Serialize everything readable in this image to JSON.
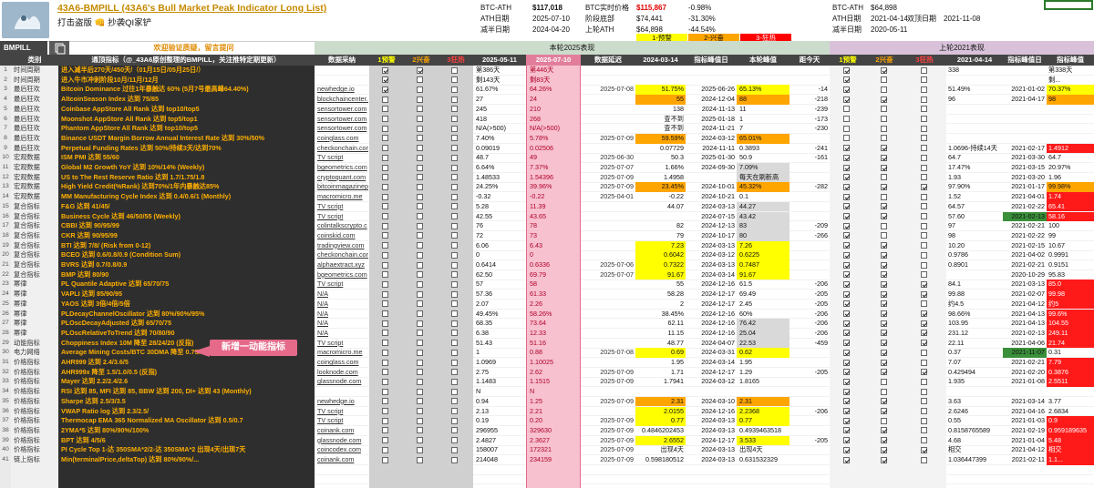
{
  "header": {
    "title": "43A6-BMPILL (43A6's Bull Market Peak Indicator Long List)",
    "subtitle": "打击盗版 👊 抄袭QI家铲",
    "current_block": [
      {
        "label": "BTC-ATH",
        "value": "$117,018",
        "v2": "BTC实时价格",
        "v3": "$115,867",
        "v4": "-0.98%"
      },
      {
        "label": "ATH日期",
        "value": "2025-07-10",
        "v2": "阶段底部",
        "v3": "$74,441",
        "v4": "-31.30%"
      },
      {
        "label": "减半日期",
        "value": "2024-04-20",
        "v2": "上轮ATH",
        "v3": "$64,898",
        "v4": "-44.54%"
      }
    ],
    "legend": {
      "warn": "1-预警",
      "alert": "2-兴奋",
      "bubble": "3-狂热"
    },
    "prev_block": [
      {
        "label": "BTC-ATH",
        "value": "$64,898",
        "v2": "",
        "v3": ""
      },
      {
        "label": "ATH日期",
        "value": "2021-04-14",
        "v2": "双顶日期",
        "v3": "2021-11-08"
      },
      {
        "label": "减半日期",
        "value": "2020-05-11",
        "v2": "",
        "v3": ""
      }
    ]
  },
  "tab": {
    "label": "BMPILL"
  },
  "banner": {
    "welcome": "欢迎验证质疑，留言提问",
    "cycle": "本轮2025表现",
    "prev_cycle": "上轮2021表现"
  },
  "columns": [
    "类别",
    "通顶指标（@_43A6原创整理的BMPILL，关注推特定期更新）",
    "数据采纳",
    "1预警",
    "2兴奋",
    "3狂热",
    "2025-05-11",
    "2025-07-10",
    "数据延迟",
    "2024-03-14",
    "指标峰值日",
    "本轮峰值",
    "距今天",
    "1预警",
    "2兴奋",
    "3狂热",
    "2021-04-14",
    "指标峰值日",
    "指标峰值"
  ],
  "rows": [
    {
      "n": "1",
      "cat": "时间周期",
      "ind": "进入减半后270天/450天/（01月15日/05月25日/）",
      "src": "",
      "c1": 1,
      "c2": 1,
      "c3": 0,
      "d1": "第386天",
      "d2": "第446天",
      "lag": "",
      "v3": "",
      "pk": "",
      "cur": "",
      "dist": "",
      "p1": 1,
      "p2": 1,
      "p3": 0,
      "o1": "338",
      "opk": "",
      "ov": "第338天"
    },
    {
      "n": "2",
      "cat": "时间周期",
      "ind": "进入牛市冲刺阶段10月/11月/12月",
      "src": "",
      "c1": 1,
      "c2": 0,
      "c3": 0,
      "d1": "剩143天",
      "d2": "剩83天",
      "lag": "",
      "v3": "",
      "pk": "",
      "cur": "",
      "dist": "",
      "p1": 1,
      "p2": 0,
      "p3": 0,
      "o1": "",
      "opk": "",
      "ov": "剩..."
    },
    {
      "n": "3",
      "cat": "最后狂欢",
      "ind": "Bitcoin Dominance 过往1年暴触达 60% (5月7号最高峰64.40%)",
      "src": "newhedge.io",
      "c1": 1,
      "c2": 0,
      "c3": 0,
      "d1": "61.67%",
      "d2": "64.26%",
      "lag": "2025-07-08",
      "v3": "51.75%",
      "pk": "2025-06-26",
      "cur": "65.13%",
      "dist": "-14",
      "p1": 1,
      "p2": 0,
      "p3": 0,
      "o1": "51.49%",
      "opk": "2021-01-02",
      "ov": "70.37%"
    },
    {
      "n": "4",
      "cat": "最后狂欢",
      "ind": "AltcoinSeason Index 达到 75/85",
      "src": "blockchaincenter.n",
      "c1": 0,
      "c2": 0,
      "c3": 0,
      "d1": "27",
      "d2": "24",
      "lag": "",
      "v3": "55",
      "pk": "2024-12-04",
      "cur": "88",
      "dist": "-218",
      "p1": 1,
      "p2": 1,
      "p3": 0,
      "o1": "96",
      "opk": "2021-04-17",
      "ov": "98"
    },
    {
      "n": "5",
      "cat": "最后狂欢",
      "ind": "Coinbase AppStore All Rank 达到 top10/top5",
      "src": "sensortower.com",
      "c1": 0,
      "c2": 0,
      "c3": 0,
      "d1": "245",
      "d2": "210",
      "lag": "",
      "v3": "138",
      "pk": "2024-11-13",
      "cur": "11",
      "dist": "-239",
      "p1": 0,
      "p2": 0,
      "p3": 0,
      "o1": "",
      "opk": "",
      "ov": ""
    },
    {
      "n": "6",
      "cat": "最后狂欢",
      "ind": "Moonshot AppStore All Rank 达到 top5/top1",
      "src": "sensortower.com",
      "c1": 0,
      "c2": 0,
      "c3": 0,
      "d1": "418",
      "d2": "268",
      "lag": "",
      "v3": "查不到",
      "pk": "2025-01-18",
      "cur": "1",
      "dist": "-173",
      "p1": 0,
      "p2": 0,
      "p3": 0,
      "o1": "",
      "opk": "",
      "ov": ""
    },
    {
      "n": "7",
      "cat": "最后狂欢",
      "ind": "Phantom AppStore All Rank 达到 top10/top5",
      "src": "sensortower.com",
      "c1": 0,
      "c2": 0,
      "c3": 0,
      "d1": "N/A(>500)",
      "d2": "N/A(>500)",
      "lag": "",
      "v3": "查不到",
      "pk": "2024-11-21",
      "cur": "7",
      "dist": "-230",
      "p1": 0,
      "p2": 0,
      "p3": 0,
      "o1": "",
      "opk": "",
      "ov": ""
    },
    {
      "n": "8",
      "cat": "最后狂欢",
      "ind": "Binance USDT Margin Borrow Annual Interest Rate 达到 30%/50%",
      "src": "coinglass.com",
      "c1": 0,
      "c2": 0,
      "c3": 0,
      "d1": "7.40%",
      "d2": "5.78%",
      "lag": "2025-07-09",
      "v3": "59.59%",
      "pk": "2024-03-12",
      "cur": "65.01%",
      "dist": "",
      "p1": 0,
      "p2": 0,
      "p3": 0,
      "o1": "",
      "opk": "",
      "ov": ""
    },
    {
      "n": "9",
      "cat": "最后狂欢",
      "ind": "Perpetual Funding Rates 达到 50%/持续3天/达到70%",
      "src": "checkonchain.com",
      "c1": 0,
      "c2": 0,
      "c3": 0,
      "d1": "0.09019",
      "d2": "0.02506",
      "lag": "",
      "v3": "0.07729",
      "pk": "2024-11-11",
      "cur": "0.3893",
      "dist": "-241",
      "p1": 1,
      "p2": 1,
      "p3": 0,
      "o1": "1.0696-持续14天",
      "opk": "2021-02-17",
      "ov": "1.4912"
    },
    {
      "n": "10",
      "cat": "宏观数据",
      "ind": "ISM PMI 达到 55/60",
      "src": "TV script",
      "c1": 0,
      "c2": 0,
      "c3": 0,
      "d1": "48.7",
      "d2": "49",
      "lag": "2025-06-30",
      "v3": "50.3",
      "pk": "2025-01-30",
      "cur": "50.9",
      "dist": "-161",
      "p1": 1,
      "p2": 1,
      "p3": 0,
      "o1": "64.7",
      "opk": "2021-03-30",
      "ov": "64.7"
    },
    {
      "n": "11",
      "cat": "宏观数据",
      "ind": "Global M2 Growth YoY 达到 10%/14% (Weekly)",
      "src": "bgeometrics.com",
      "c1": 0,
      "c2": 0,
      "c3": 0,
      "d1": "6.64%",
      "d2": "7.37%",
      "lag": "2025-07-07",
      "v3": "1.66%",
      "pk": "2024-09-30",
      "cur": "7.09%",
      "dist": "",
      "p1": 1,
      "p2": 1,
      "p3": 0,
      "o1": "17.47%",
      "opk": "2021-03-15",
      "ov": "20.97%"
    },
    {
      "n": "12",
      "cat": "宏观数据",
      "ind": "US to The Rest Reserve Ratio 达到 1.7/1.75/1.8",
      "src": "cryptoquant.com",
      "c1": 0,
      "c2": 0,
      "c3": 0,
      "d1": "1.48533",
      "d2": "1.54396",
      "lag": "2025-07-09",
      "v3": "1.4958",
      "pk": "",
      "cur": "每天在刷新高",
      "dist": "",
      "p1": 1,
      "p2": 0,
      "p3": 0,
      "o1": "1.93",
      "opk": "2021-03-20",
      "ov": "1.96"
    },
    {
      "n": "13",
      "cat": "宏观数据",
      "ind": "High Yield Credit(%Rank) 达到70%/1年内暴触达85%",
      "src": "bitcoinmagazinepro",
      "c1": 0,
      "c2": 0,
      "c3": 0,
      "d1": "24.25%",
      "d2": "39.96%",
      "lag": "2025-07-09",
      "v3": "23.45%",
      "pk": "2024-10-01",
      "cur": "45.32%",
      "dist": "-282",
      "p1": 1,
      "p2": 1,
      "p3": 1,
      "o1": "97.90%",
      "opk": "2021-01-17",
      "ov": "99.98%"
    },
    {
      "n": "14",
      "cat": "宏观数据",
      "ind": "MM Manufacturing Cycle Index 达到 0.4/0.6/1 (Monthly)",
      "src": "macromicro.me",
      "c1": 0,
      "c2": 0,
      "c3": 0,
      "d1": "-0.32",
      "d2": "-0.22",
      "lag": "2025-04-01",
      "v3": "-0.22",
      "pk": "2024-10-21",
      "cur": "0.1",
      "dist": "",
      "p1": 1,
      "p2": 0,
      "p3": 0,
      "o1": "1.52",
      "opk": "2021-04-01",
      "ov": "1.74"
    },
    {
      "n": "15",
      "cat": "复合指标",
      "ind": "F&G 达到 41/45/",
      "src": "TV script",
      "c1": 0,
      "c2": 0,
      "c3": 0,
      "d1": "5.28",
      "d2": "11.39",
      "lag": "",
      "v3": "44.07",
      "pk": "2024-03-13",
      "cur": "44.27",
      "dist": "",
      "p1": 1,
      "p2": 1,
      "p3": 0,
      "o1": "64.57",
      "opk": "2021-02-22",
      "ov": "65.41"
    },
    {
      "n": "16",
      "cat": "复合指标",
      "ind": "Business Cycle 达到 46/50/55 (Weekly)",
      "src": "TV script",
      "c1": 0,
      "c2": 0,
      "c3": 0,
      "d1": "42.55",
      "d2": "43.65",
      "lag": "",
      "v3": "",
      "pk": "2024-07-15",
      "cur": "43.42",
      "dist": "",
      "p1": 1,
      "p2": 1,
      "p3": 0,
      "o1": "57.60",
      "opk": "2021-02-13",
      "ov": "58.16"
    },
    {
      "n": "17",
      "cat": "复合指标",
      "ind": "CBBI 达到 90/95/99",
      "src": "colintalkscrypto.c",
      "c1": 0,
      "c2": 0,
      "c3": 0,
      "d1": "76",
      "d2": "78",
      "lag": "",
      "v3": "82",
      "pk": "2024-12-13",
      "cur": "83",
      "dist": "-209",
      "p1": 1,
      "p2": 0,
      "p3": 0,
      "o1": "97",
      "opk": "2021-02-21",
      "ov": "100"
    },
    {
      "n": "18",
      "cat": "复合指标",
      "ind": "CKR 达到 90/95/99",
      "src": "coinskid.com",
      "c1": 0,
      "c2": 0,
      "c3": 0,
      "d1": "72",
      "d2": "73",
      "lag": "",
      "v3": "79",
      "pk": "2024-10-17",
      "cur": "80",
      "dist": "-266",
      "p1": 1,
      "p2": 0,
      "p3": 0,
      "o1": "98",
      "opk": "2021-02-22",
      "ov": "99"
    },
    {
      "n": "19",
      "cat": "复合指标",
      "ind": "BTI 达到 7/8/ (Risk from 0-12)",
      "src": "tradingview.com",
      "c1": 0,
      "c2": 0,
      "c3": 0,
      "d1": "6.06",
      "d2": "6.43",
      "lag": "",
      "v3": "7.23",
      "pk": "2024-03-13",
      "cur": "7.26",
      "dist": "",
      "p1": 1,
      "p2": 1,
      "p3": 0,
      "o1": "10.20",
      "opk": "2021-02-15",
      "ov": "10.67"
    },
    {
      "n": "20",
      "cat": "复合指标",
      "ind": "BCEO 达到 0.6/0.8/0.9 (Condition Sum)",
      "src": "checkonchain.com",
      "c1": 0,
      "c2": 0,
      "c3": 0,
      "d1": "0",
      "d2": "0",
      "lag": "",
      "v3": "0.6042",
      "pk": "2024-03-12",
      "cur": "0.6225",
      "dist": "",
      "p1": 1,
      "p2": 1,
      "p3": 0,
      "o1": "0.9786",
      "opk": "2021-04-02",
      "ov": "0.9991"
    },
    {
      "n": "21",
      "cat": "复合指标",
      "ind": "BVRS 达到 0.7/0.8/0.9",
      "src": "alphaextract.xyz",
      "c1": 0,
      "c2": 0,
      "c3": 0,
      "d1": "0.6414",
      "d2": "0.6336",
      "lag": "2025-07-06",
      "v3": "0.7322",
      "pk": "2024-03-13",
      "cur": "0.7487",
      "dist": "",
      "p1": 1,
      "p2": 1,
      "p3": 0,
      "o1": "0.8901",
      "opk": "2021-02-21",
      "ov": "0.9151"
    },
    {
      "n": "22",
      "cat": "复合指标",
      "ind": "BMP 达到 80/90",
      "src": "bgeometrics.com",
      "c1": 0,
      "c2": 0,
      "c3": 0,
      "d1": "62.50",
      "d2": "69.79",
      "lag": "2025-07-07",
      "v3": "91.67",
      "pk": "2024-03-14",
      "cur": "91.67",
      "dist": "",
      "p1": 1,
      "p2": 1,
      "p3": 0,
      "o1": "",
      "opk": "2020-10-29",
      "ov": "95.83"
    },
    {
      "n": "23",
      "cat": "幂律",
      "ind": "PL Quantile Adaptive 达到 65/70/75",
      "src": "TV script",
      "c1": 0,
      "c2": 0,
      "c3": 0,
      "d1": "57",
      "d2": "58",
      "lag": "",
      "v3": "55",
      "pk": "2024-12-16",
      "cur": "61.5",
      "dist": "-206",
      "p1": 1,
      "p2": 1,
      "p3": 1,
      "o1": "84.1",
      "opk": "2021-03-13",
      "ov": "85.0"
    },
    {
      "n": "24",
      "cat": "幂律",
      "ind": "VAPLI 达到 85/90/95",
      "src": "N/A",
      "c1": 0,
      "c2": 0,
      "c3": 0,
      "d1": "57.36",
      "d2": "61.33",
      "lag": "",
      "v3": "58.28",
      "pk": "2024-12-17",
      "cur": "69.49",
      "dist": "-205",
      "p1": 1,
      "p2": 1,
      "p3": 1,
      "o1": "99.88",
      "opk": "2021-02-07",
      "ov": "99.98"
    },
    {
      "n": "25",
      "cat": "幂律",
      "ind": "YAOS 达到 3倍/4倍/5倍",
      "src": "N/A",
      "c1": 0,
      "c2": 0,
      "c3": 0,
      "d1": "2.07",
      "d2": "2.26",
      "lag": "",
      "v3": "2",
      "pk": "2024-12-17",
      "cur": "2.45",
      "dist": "-205",
      "p1": 1,
      "p2": 1,
      "p3": 0,
      "o1": "约4.5",
      "opk": "2021-04-12",
      "ov": "约5"
    },
    {
      "n": "26",
      "cat": "幂律",
      "ind": "PLDecayChannelOscillator 达到 80%/90%/95%",
      "src": "N/A",
      "c1": 0,
      "c2": 0,
      "c3": 0,
      "d1": "49.45%",
      "d2": "58.26%",
      "lag": "",
      "v3": "38.45%",
      "pk": "2024-12-16",
      "cur": "60%",
      "dist": "-206",
      "p1": 1,
      "p2": 1,
      "p3": 1,
      "o1": "98.66%",
      "opk": "2021-04-13",
      "ov": "99.6%"
    },
    {
      "n": "27",
      "cat": "幂律",
      "ind": "PLOscDecayAdjusted 达到 65/70/75",
      "src": "N/A",
      "c1": 0,
      "c2": 0,
      "c3": 0,
      "d1": "68.35",
      "d2": "73.64",
      "lag": "",
      "v3": "62.11",
      "pk": "2024-12-16",
      "cur": "76.42",
      "dist": "-206",
      "p1": 1,
      "p2": 1,
      "p3": 1,
      "o1": "103.95",
      "opk": "2021-04-13",
      "ov": "104.55"
    },
    {
      "n": "28",
      "cat": "幂律",
      "ind": "PLOscRelativeToTrend 达到 70/80/90",
      "src": "N/A",
      "c1": 0,
      "c2": 0,
      "c3": 0,
      "d1": "6.38",
      "d2": "12.33",
      "lag": "",
      "v3": "11.15",
      "pk": "2024-12-16",
      "cur": "25.04",
      "dist": "-206",
      "p1": 1,
      "p2": 1,
      "p3": 1,
      "o1": "231.12",
      "opk": "2021-02-13",
      "ov": "249.11"
    },
    {
      "n": "29",
      "cat": "动能指标",
      "ind": "Choppiness Index 10M 降至 28/24/20 (反指)",
      "src": "TV script",
      "c1": 0,
      "c2": 0,
      "c3": 0,
      "d1": "51.43",
      "d2": "51.16",
      "lag": "",
      "v3": "48.77",
      "pk": "2024-04-07",
      "cur": "22.53",
      "dist": "-459",
      "p1": 1,
      "p2": 1,
      "p3": 1,
      "o1": "22.11",
      "opk": "2021-04-06",
      "ov": "21.74"
    },
    {
      "n": "30",
      "cat": "电力网络",
      "ind": "Average Mining Costs/BTC 30DMA 降至 0.75/0.5/0.45 (反指)",
      "src": "macromicro.me",
      "c1": 0,
      "c2": 0,
      "c3": 0,
      "d1": "1",
      "d2": "0.88",
      "lag": "2025-07-08",
      "v3": "0.69",
      "pk": "2024-03-31",
      "cur": "0.62",
      "dist": "",
      "p1": 1,
      "p2": 1,
      "p3": 0,
      "o1": "0.37",
      "opk": "2021-11-07",
      "ov": "0.31"
    },
    {
      "n": "31",
      "cat": "价格指标",
      "ind": "AHR999 达到 2.4/3.6/5",
      "src": "coinglass.com",
      "c1": 0,
      "c2": 0,
      "c3": 0,
      "d1": "1.0969",
      "d2": "1.10025",
      "lag": "",
      "v3": "1.95",
      "pk": "2024-03-14",
      "cur": "1.95",
      "dist": "",
      "p1": 1,
      "p2": 1,
      "p3": 0,
      "o1": "7.07",
      "opk": "2021-02-21",
      "ov": "7.79"
    },
    {
      "n": "32",
      "cat": "价格指标",
      "ind": "AHR999x 降至 1.5/1.0/0.5 (反指)",
      "src": "looknode.com",
      "c1": 0,
      "c2": 0,
      "c3": 0,
      "d1": "2.75",
      "d2": "2.62",
      "lag": "2025-07-09",
      "v3": "1.71",
      "pk": "2024-12-17",
      "cur": "1.29",
      "dist": "-205",
      "p1": 1,
      "p2": 1,
      "p3": 1,
      "o1": "0.429494",
      "opk": "2021-02-20",
      "ov": "0.3876"
    },
    {
      "n": "33",
      "cat": "价格指标",
      "ind": "Mayer 达到 2.2/2.4/2.6",
      "src": "glassnode.com",
      "c1": 0,
      "c2": 0,
      "c3": 0,
      "d1": "1.1483",
      "d2": "1.1515",
      "lag": "2025-07-09",
      "v3": "1.7941",
      "pk": "2024-03-12",
      "cur": "1.8165",
      "dist": "",
      "p1": 1,
      "p2": 0,
      "p3": 0,
      "o1": "1.935",
      "opk": "2021-01-08",
      "ov": "2.5511"
    },
    {
      "n": "34",
      "cat": "价格指标",
      "ind": "RSI 达到 85, MFI 达到 85, BBW 达到 200, DI+ 达到 43 (Monthly)",
      "src": "",
      "c1": 0,
      "c2": 0,
      "c3": 0,
      "d1": "N",
      "d2": "N",
      "lag": "",
      "v3": "",
      "pk": "",
      "cur": "",
      "dist": "",
      "p1": 1,
      "p2": 0,
      "p3": 0,
      "o1": "",
      "opk": "",
      "ov": ""
    },
    {
      "n": "35",
      "cat": "价格指标",
      "ind": "Sharpe 达到 2.5/3/3.5",
      "src": "newhedge.io",
      "c1": 0,
      "c2": 0,
      "c3": 0,
      "d1": "0.94",
      "d2": "1.25",
      "lag": "2025-07-09",
      "v3": "2.31",
      "pk": "2024-03-10",
      "cur": "2.31",
      "dist": "",
      "p1": 1,
      "p2": 1,
      "p3": 0,
      "o1": "3.63",
      "opk": "2021-03-14",
      "ov": "3.77"
    },
    {
      "n": "36",
      "cat": "价格指标",
      "ind": "VWAP Ratio log 达到 2.3/2.5/",
      "src": "TV script",
      "c1": 0,
      "c2": 0,
      "c3": 0,
      "d1": "2.13",
      "d2": "2.21",
      "lag": "",
      "v3": "2.0155",
      "pk": "2024-12-16",
      "cur": "2.2368",
      "dist": "-206",
      "p1": 1,
      "p2": 1,
      "p3": 0,
      "o1": "2.6246",
      "opk": "2021-04-16",
      "ov": "2.6834"
    },
    {
      "n": "37",
      "cat": "价格指标",
      "ind": "Thermocap EMA 365 Normalized MA Oscillator 达到 0.5/0.7",
      "src": "TV script",
      "c1": 0,
      "c2": 0,
      "c3": 0,
      "d1": "0.19",
      "d2": "0.20",
      "lag": "2025-07-09",
      "v3": "0.77",
      "pk": "2024-03-13",
      "cur": "0.77",
      "dist": "",
      "p1": 1,
      "p2": 0,
      "p3": 0,
      "o1": "0.55",
      "opk": "2021-01-03",
      "ov": "0.9"
    },
    {
      "n": "38",
      "cat": "价格指标",
      "ind": "2YMA*5 达到 80%/90%/100%",
      "src": "coinank.com",
      "c1": 0,
      "c2": 0,
      "c3": 0,
      "d1": "296955",
      "d2": "329630",
      "lag": "2025-07-09",
      "v3": "0.4846202453",
      "pk": "2024-03-13",
      "cur": "0.4939463518",
      "dist": "",
      "p1": 1,
      "p2": 1,
      "p3": 0,
      "o1": "0.8158765589",
      "opk": "2021-02-19",
      "ov": "0.959189635"
    },
    {
      "n": "39",
      "cat": "价格指标",
      "ind": "BPT 达到 4/5/6",
      "src": "glassnode.com",
      "c1": 0,
      "c2": 0,
      "c3": 0,
      "d1": "2.4827",
      "d2": "2.3627",
      "lag": "2025-07-09",
      "v3": "2.6552",
      "pk": "2024-12-17",
      "cur": "3.533",
      "dist": "-205",
      "p1": 1,
      "p2": 1,
      "p3": 0,
      "o1": "4.68",
      "opk": "2021-01-04",
      "ov": "5.48"
    },
    {
      "n": "40",
      "cat": "价格指标",
      "ind": "PI Cycle Top 1-达 350SMA*2/2-达 350SMA*2 出现4天/出现7天",
      "src": "coincodex.com",
      "c1": 0,
      "c2": 0,
      "c3": 0,
      "d1": "158007",
      "d2": "172321",
      "lag": "2025-07-09",
      "v3": "出现4天",
      "pk": "2024-03-13",
      "cur": "出现4天",
      "dist": "",
      "p1": 1,
      "p2": 1,
      "p3": 1,
      "o1": "相交",
      "opk": "2021-04-12",
      "ov": "相交"
    },
    {
      "n": "41",
      "cat": "链上指标",
      "ind": "Min(terminalPrice,deltaTop) 达到 80%/90%/...",
      "src": "coinank.com",
      "c1": 0,
      "c2": 0,
      "c3": 0,
      "d1": "214048",
      "d2": "234159",
      "lag": "2025-07-09",
      "v3": "0.598180512",
      "pk": "2024-03-13",
      "cur": "0.631532329",
      "dist": "",
      "p1": 1,
      "p2": 1,
      "p3": 0,
      "o1": "1.036447399",
      "opk": "2021-02-11",
      "ov": "1.1..."
    }
  ],
  "callout": {
    "text": "新增一动能指标"
  },
  "colors": {
    "warn": "#ffff00",
    "alert": "#ffa500",
    "bubble": "#ff0000",
    "orange_text": "#e08a00",
    "highlight_col": "#f5a9bd",
    "red": "#e00000",
    "green": "#3a8f3a",
    "gray": "#d9d9d9"
  }
}
